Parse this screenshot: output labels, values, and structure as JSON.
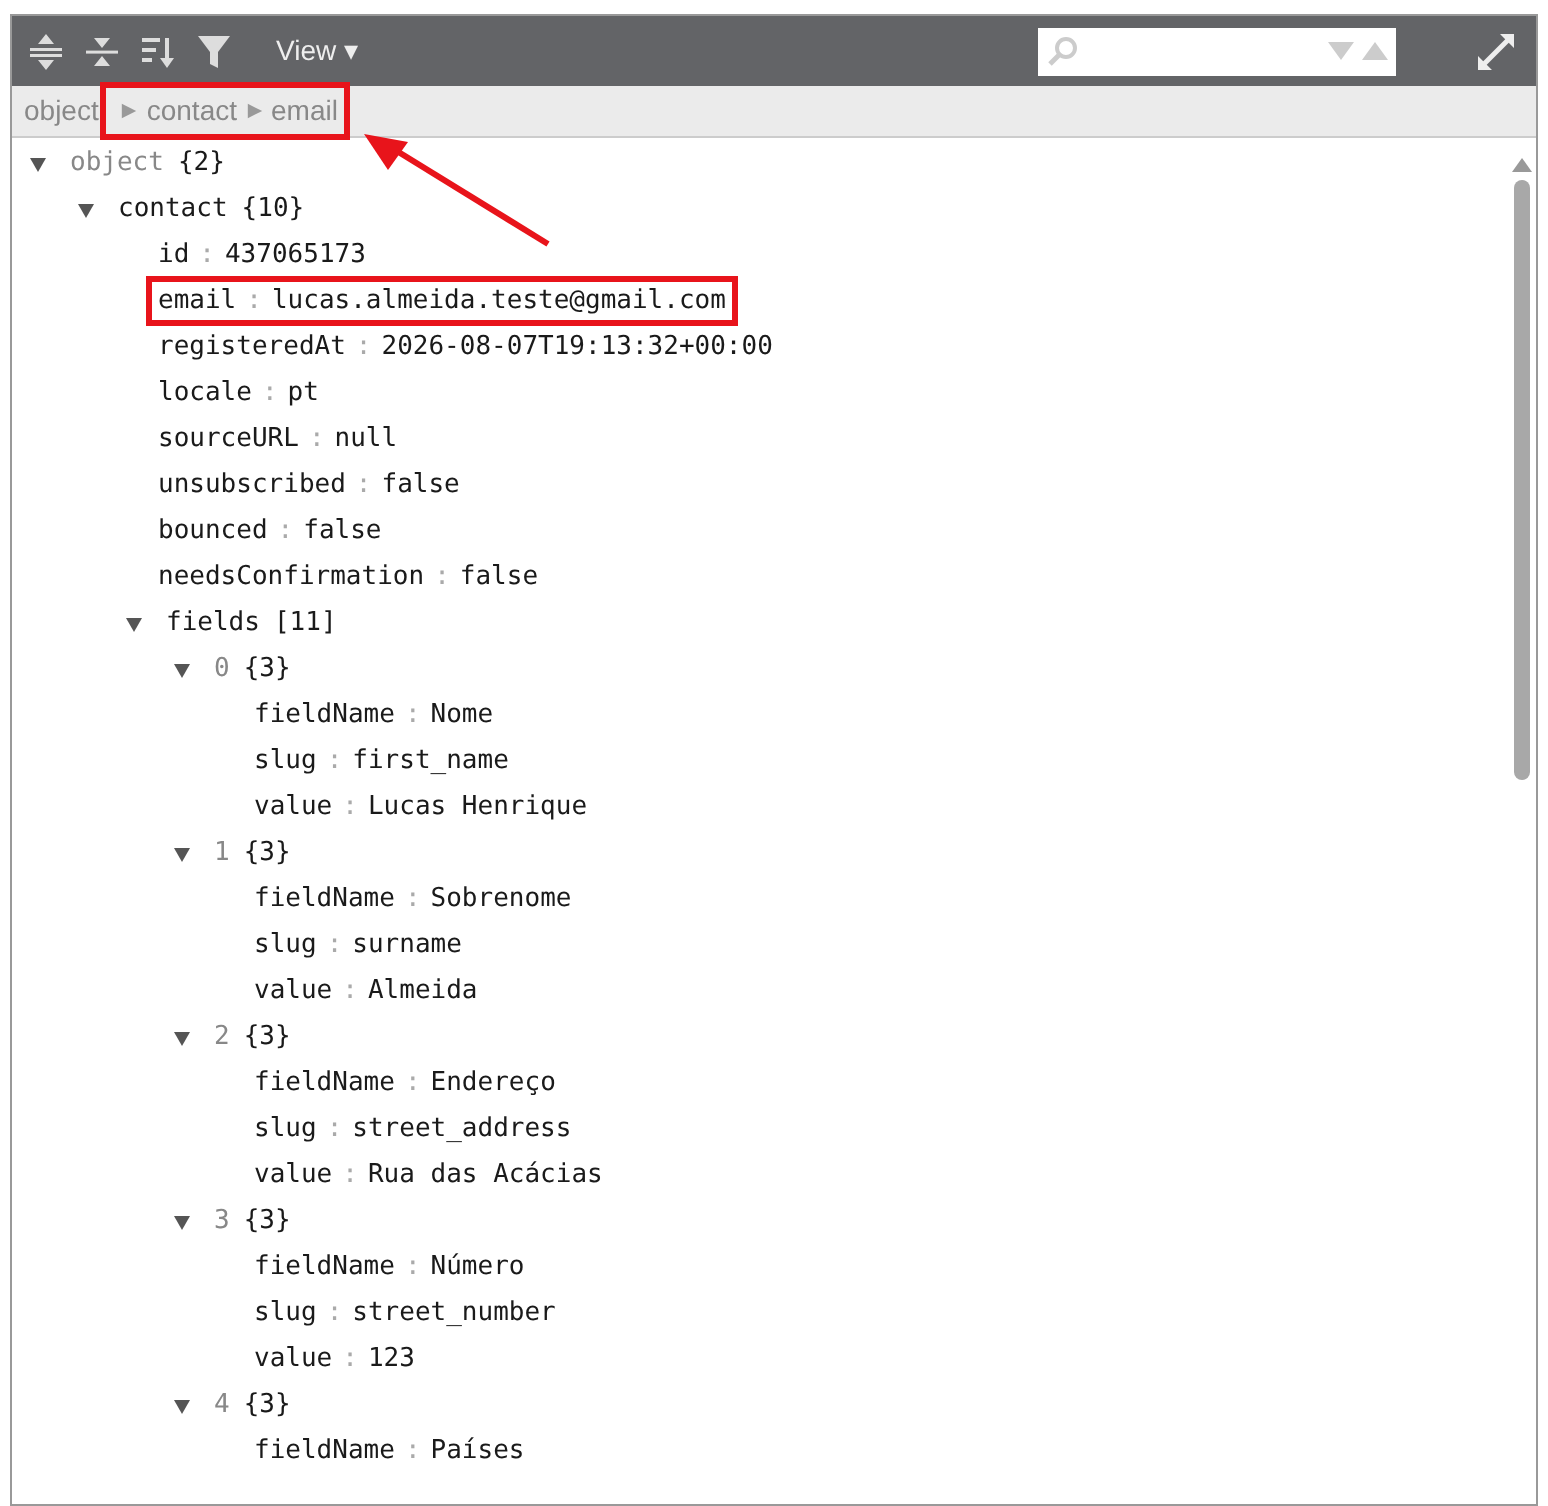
{
  "toolbar": {
    "view_menu": "View ▾"
  },
  "separator": ":",
  "breadcrumb": [
    {
      "label": "object",
      "highlighted": false
    },
    {
      "label": "contact",
      "highlighted": true
    },
    {
      "label": "email",
      "highlighted": true
    }
  ],
  "tree": {
    "kind": "node",
    "muted": true,
    "key": "object",
    "count": "{2}",
    "expanded": true,
    "children": [
      {
        "kind": "node",
        "muted": false,
        "key": "contact",
        "count": "{10}",
        "expanded": true,
        "children": [
          {
            "kind": "value",
            "key": "id",
            "value": "437065173",
            "highlighted": false
          },
          {
            "kind": "value",
            "key": "email",
            "value": "lucas.almeida.teste@gmail.com",
            "highlighted": true
          },
          {
            "kind": "value",
            "key": "registeredAt",
            "value": "2026-08-07T19:13:32+00:00",
            "highlighted": false
          },
          {
            "kind": "value",
            "key": "locale",
            "value": "pt",
            "highlighted": false
          },
          {
            "kind": "value",
            "key": "sourceURL",
            "value": "null",
            "highlighted": false
          },
          {
            "kind": "value",
            "key": "unsubscribed",
            "value": "false",
            "highlighted": false
          },
          {
            "kind": "value",
            "key": "bounced",
            "value": "false",
            "highlighted": false
          },
          {
            "kind": "value",
            "key": "needsConfirmation",
            "value": "false",
            "highlighted": false
          },
          {
            "kind": "node",
            "muted": false,
            "key": "fields",
            "count": "[11]",
            "expanded": true,
            "children": [
              {
                "kind": "node",
                "muted": true,
                "key": "0",
                "count": "{3}",
                "expanded": true,
                "children": [
                  {
                    "kind": "value",
                    "key": "fieldName",
                    "value": "Nome",
                    "highlighted": false
                  },
                  {
                    "kind": "value",
                    "key": "slug",
                    "value": "first_name",
                    "highlighted": false
                  },
                  {
                    "kind": "value",
                    "key": "value",
                    "value": "Lucas Henrique",
                    "highlighted": false
                  }
                ]
              },
              {
                "kind": "node",
                "muted": true,
                "key": "1",
                "count": "{3}",
                "expanded": true,
                "children": [
                  {
                    "kind": "value",
                    "key": "fieldName",
                    "value": "Sobrenome",
                    "highlighted": false
                  },
                  {
                    "kind": "value",
                    "key": "slug",
                    "value": "surname",
                    "highlighted": false
                  },
                  {
                    "kind": "value",
                    "key": "value",
                    "value": "Almeida",
                    "highlighted": false
                  }
                ]
              },
              {
                "kind": "node",
                "muted": true,
                "key": "2",
                "count": "{3}",
                "expanded": true,
                "children": [
                  {
                    "kind": "value",
                    "key": "fieldName",
                    "value": "Endereço",
                    "highlighted": false
                  },
                  {
                    "kind": "value",
                    "key": "slug",
                    "value": "street_address",
                    "highlighted": false
                  },
                  {
                    "kind": "value",
                    "key": "value",
                    "value": "Rua das Acácias",
                    "highlighted": false
                  }
                ]
              },
              {
                "kind": "node",
                "muted": true,
                "key": "3",
                "count": "{3}",
                "expanded": true,
                "children": [
                  {
                    "kind": "value",
                    "key": "fieldName",
                    "value": "Número",
                    "highlighted": false
                  },
                  {
                    "kind": "value",
                    "key": "slug",
                    "value": "street_number",
                    "highlighted": false
                  },
                  {
                    "kind": "value",
                    "key": "value",
                    "value": "123",
                    "highlighted": false
                  }
                ]
              },
              {
                "kind": "node",
                "muted": true,
                "key": "4",
                "count": "{3}",
                "expanded": true,
                "children": [
                  {
                    "kind": "value",
                    "key": "fieldName",
                    "value": "Países",
                    "highlighted": false
                  }
                ]
              }
            ]
          }
        ]
      }
    ]
  }
}
